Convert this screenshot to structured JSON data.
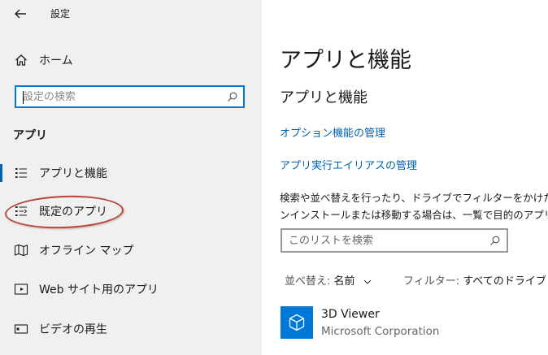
{
  "window": {
    "title": "設定"
  },
  "sidebar": {
    "home_label": "ホーム",
    "search_placeholder": "設定の検索",
    "section_heading": "アプリ",
    "items": [
      {
        "label": "アプリと機能",
        "icon": "apps-features-icon",
        "active": true
      },
      {
        "label": "既定のアプリ",
        "icon": "default-apps-icon",
        "active": false
      },
      {
        "label": "オフライン マップ",
        "icon": "offline-maps-icon",
        "active": false
      },
      {
        "label": "Web サイト用のアプリ",
        "icon": "apps-for-websites-icon",
        "active": false
      },
      {
        "label": "ビデオの再生",
        "icon": "video-playback-icon",
        "active": false
      }
    ]
  },
  "main": {
    "title": "アプリと機能",
    "subheading": "アプリと機能",
    "links": [
      "オプション機能の管理",
      "アプリ実行エイリアスの管理"
    ],
    "description": [
      "検索や並べ替えを行ったり、ドライブでフィルターをかけたり",
      "ンインストールまたは移動する場合は、一覧で目的のアプリ"
    ],
    "list_search_placeholder": "このリストを検索",
    "sort": {
      "label": "並べ替え:",
      "value": "名前"
    },
    "filter": {
      "label": "フィルター:",
      "value": "すべてのドライブ"
    },
    "apps": [
      {
        "name": "3D Viewer",
        "publisher": "Microsoft Corporation",
        "icon": "3d-viewer-icon"
      }
    ]
  },
  "colors": {
    "accent": "#0078d7",
    "link": "#0063b1",
    "sidebar_bg": "#f0f0f0",
    "annotation": "#b5473a"
  }
}
